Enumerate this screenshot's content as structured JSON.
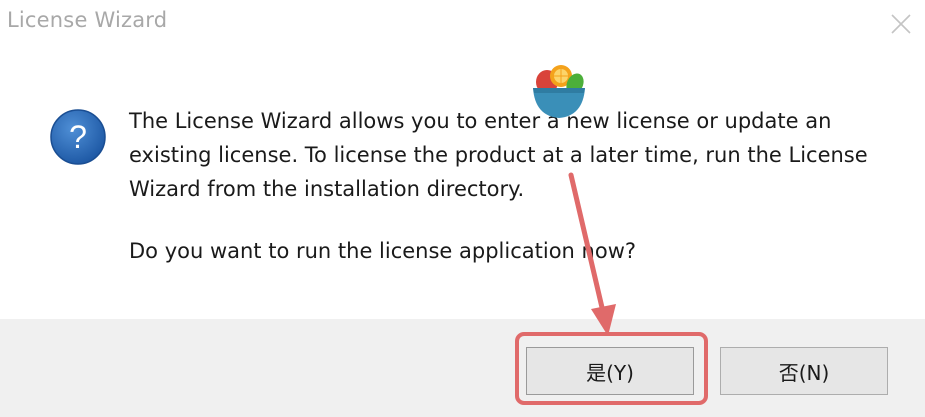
{
  "window": {
    "title": "License Wizard"
  },
  "message": {
    "line1": "The License Wizard allows you to enter a new license or update an",
    "line2": "existing license. To license the product at a later time, run the License",
    "line3": "Wizard from the installation directory.",
    "question": "Do you want to run the license application now?"
  },
  "buttons": {
    "yes_label": "是(Y)",
    "no_label": "否(N)"
  },
  "icons": {
    "dialog_icon": "question-icon",
    "close": "close-icon"
  },
  "colors": {
    "question_icon_fill": "#2b6bb5",
    "annotation": "#e06a6a",
    "footer_bg": "#f0f0f0",
    "title_text": "#a8a8a8"
  }
}
